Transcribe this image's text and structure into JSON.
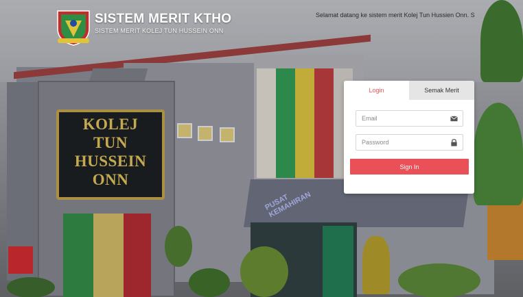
{
  "header": {
    "site_title": "SISTEM MERIT KTHO",
    "site_subtitle": "SISTEM MERIT KOLEJ TUN HUSSEIN ONN",
    "welcome_text": "Selamat datang ke sistem merit Kolej Tun Hussien Onn. S",
    "logo_icon": "college-crest-icon"
  },
  "background": {
    "sign_text": [
      "KOLEJ",
      "TUN",
      "HUSSEIN",
      "ONN"
    ],
    "canopy_text": [
      "PUSAT",
      "KEMAHIRAN"
    ]
  },
  "login_card": {
    "tabs": [
      {
        "label": "Login",
        "active": true
      },
      {
        "label": "Semak Merit",
        "active": false
      }
    ],
    "email_placeholder": "Email",
    "email_icon": "envelope-icon",
    "password_placeholder": "Password",
    "password_icon": "lock-icon",
    "signin_label": "Sign In"
  },
  "colors": {
    "accent": "#ea5057",
    "active_tab_text": "#e8515a",
    "inactive_tab_bg": "#e5e5e5"
  }
}
